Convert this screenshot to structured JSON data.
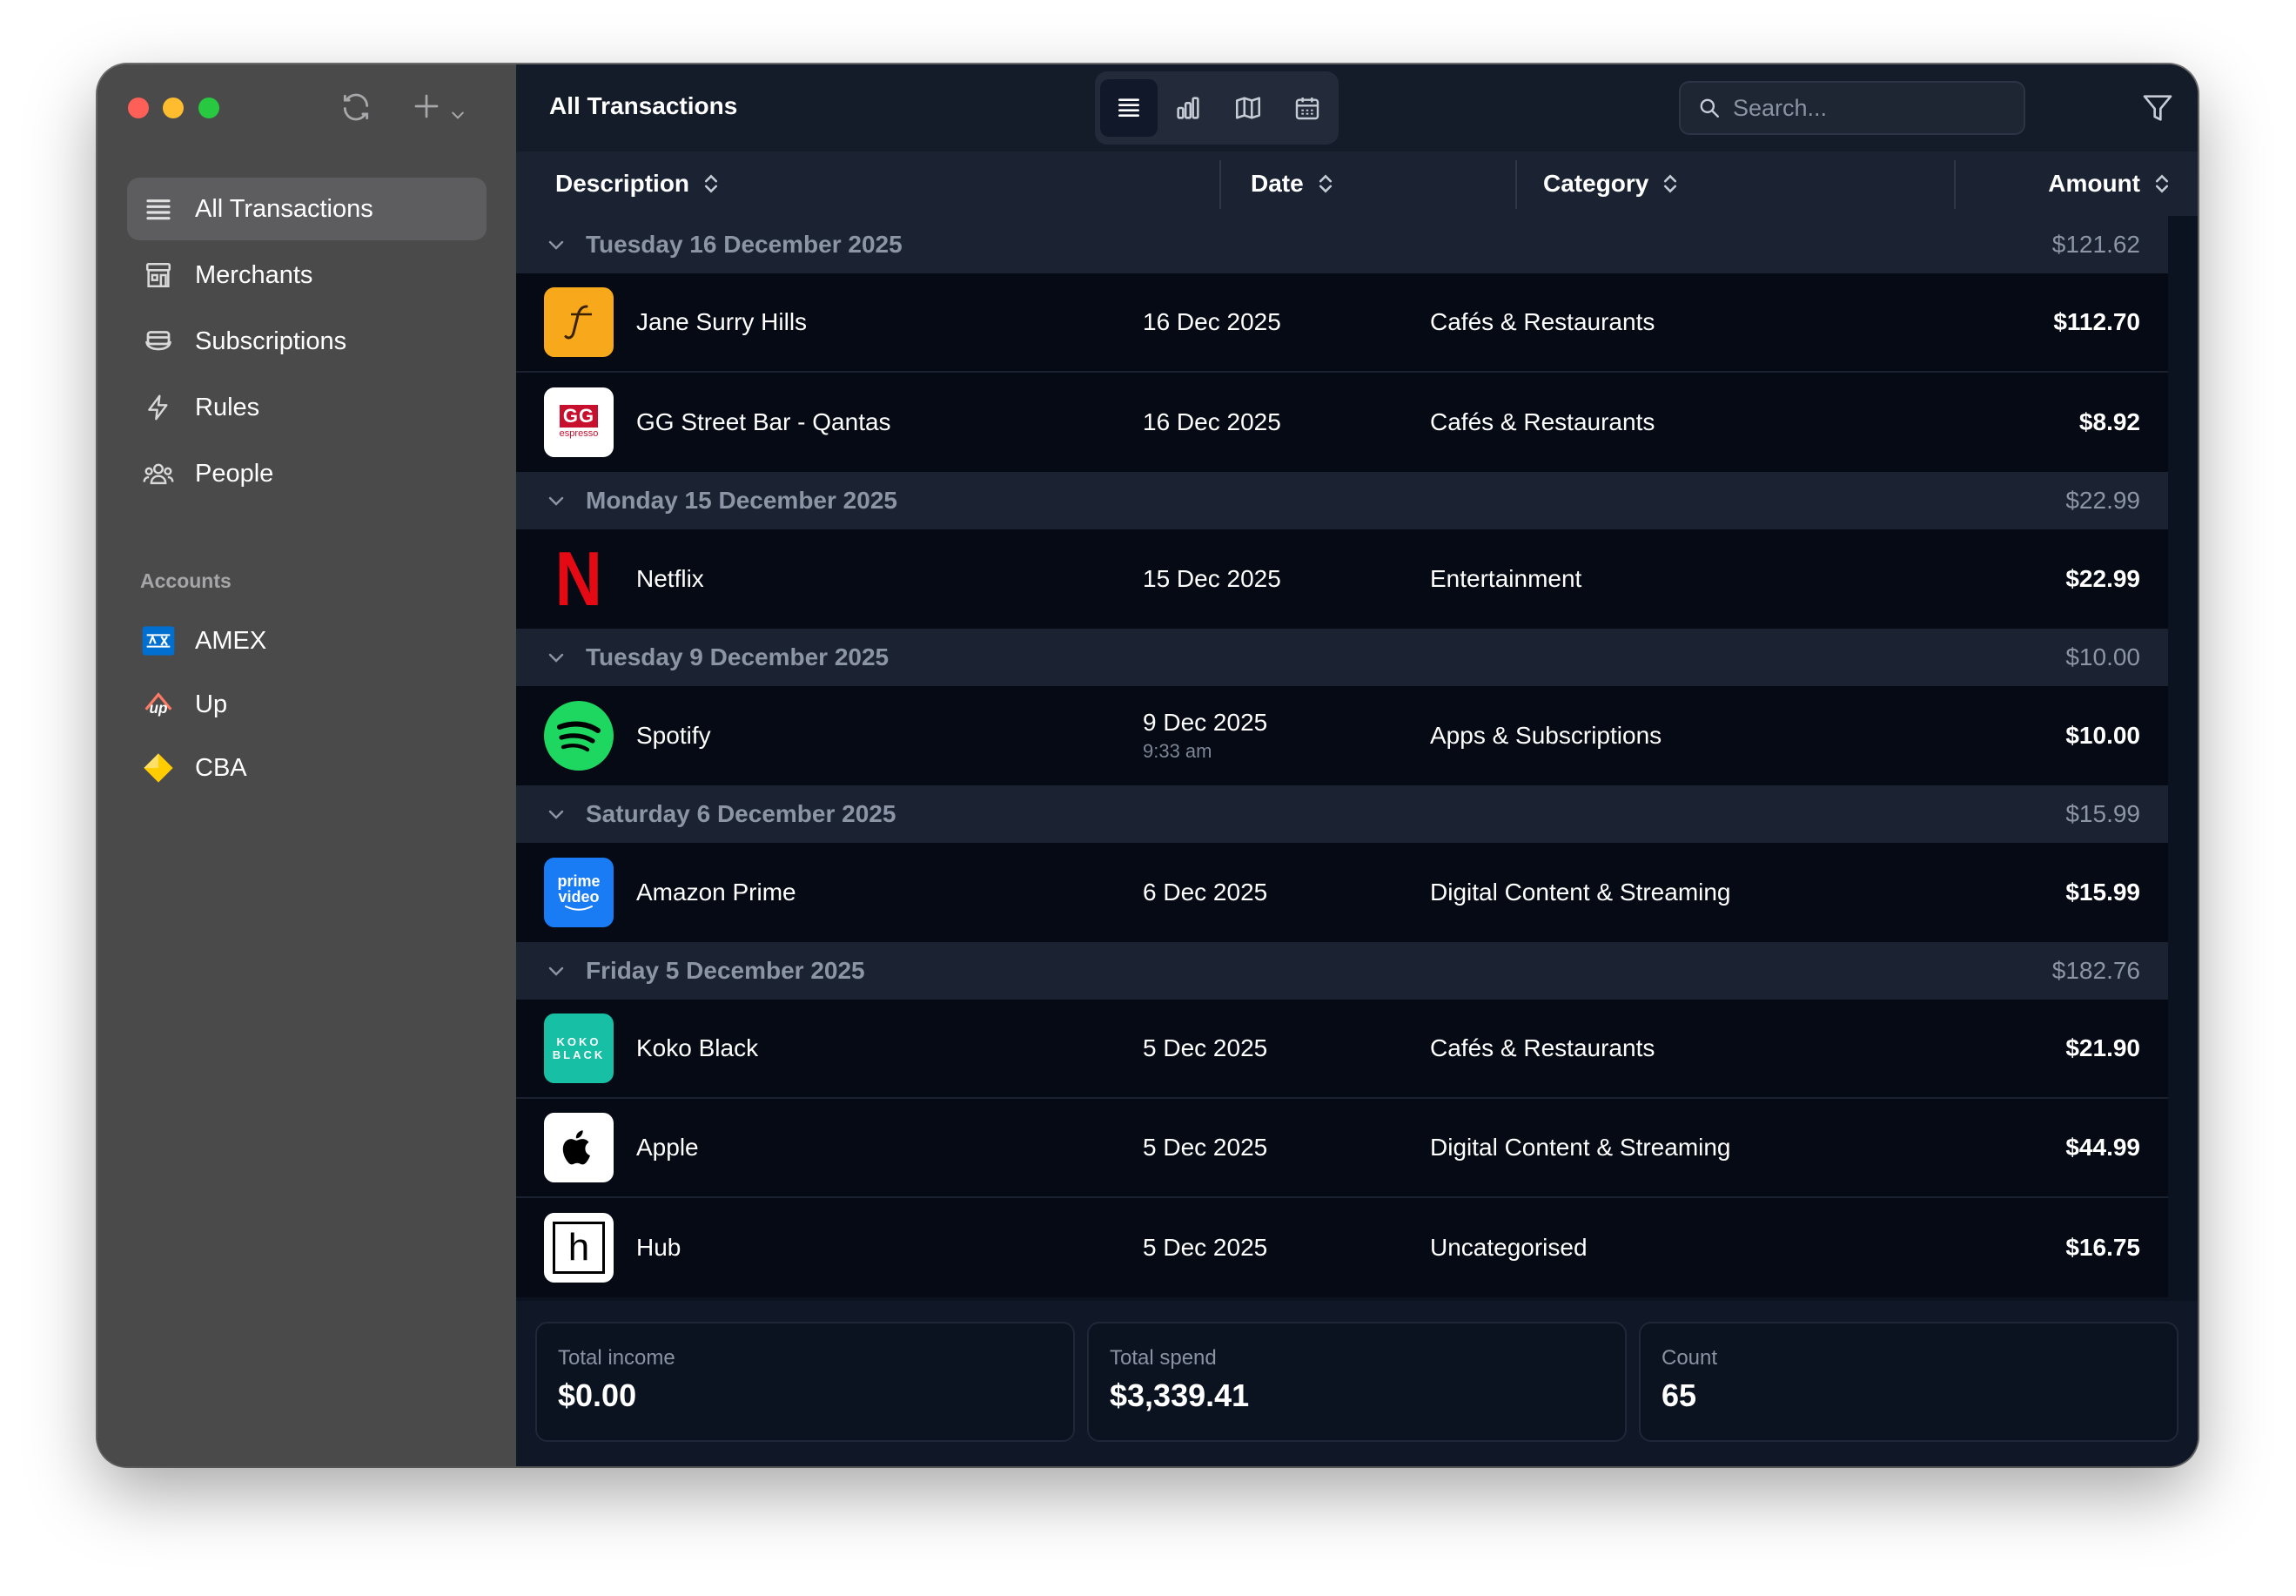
{
  "title": "All Transactions",
  "search": {
    "placeholder": "Search..."
  },
  "sidebar": {
    "items": [
      {
        "label": "All Transactions",
        "icon": "list-icon"
      },
      {
        "label": "Merchants",
        "icon": "store-icon"
      },
      {
        "label": "Subscriptions",
        "icon": "subscriptions-icon"
      },
      {
        "label": "Rules",
        "icon": "bolt-icon"
      },
      {
        "label": "People",
        "icon": "people-icon"
      }
    ],
    "accounts_heading": "Accounts",
    "accounts": [
      {
        "label": "AMEX",
        "color": "#016fd0"
      },
      {
        "label": "Up",
        "color": "#ff7a64"
      },
      {
        "label": "CBA",
        "color": "#ffcc00"
      }
    ]
  },
  "columns": {
    "description": "Description",
    "date": "Date",
    "category": "Category",
    "amount": "Amount"
  },
  "groups": [
    {
      "date": "Tuesday 16 December 2025",
      "total": "$121.62",
      "rows": [
        {
          "desc": "Jane Surry Hills",
          "date": "16 Dec 2025",
          "category": "Cafés & Restaurants",
          "amount": "$112.70",
          "logo": "jane-logo"
        },
        {
          "desc": "GG Street Bar - Qantas",
          "date": "16 Dec 2025",
          "category": "Cafés & Restaurants",
          "amount": "$8.92",
          "logo": "gg-espresso-logo",
          "logo_text": "GG",
          "logo_sub": "espresso"
        }
      ]
    },
    {
      "date": "Monday 15 December 2025",
      "total": "$22.99",
      "rows": [
        {
          "desc": "Netflix",
          "date": "15 Dec 2025",
          "category": "Entertainment",
          "amount": "$22.99",
          "logo": "netflix-logo",
          "logo_text": "N"
        }
      ]
    },
    {
      "date": "Tuesday 9 December 2025",
      "total": "$10.00",
      "rows": [
        {
          "desc": "Spotify",
          "date": "9 Dec 2025",
          "time": "9:33 am",
          "category": "Apps & Subscriptions",
          "amount": "$10.00",
          "logo": "spotify-logo"
        }
      ]
    },
    {
      "date": "Saturday 6 December 2025",
      "total": "$15.99",
      "rows": [
        {
          "desc": "Amazon Prime",
          "date": "6 Dec 2025",
          "category": "Digital Content & Streaming",
          "amount": "$15.99",
          "logo": "prime-video-logo",
          "logo_text": "prime",
          "logo_sub": "video"
        }
      ]
    },
    {
      "date": "Friday 5 December 2025",
      "total": "$182.76",
      "rows": [
        {
          "desc": "Koko Black",
          "date": "5 Dec 2025",
          "category": "Cafés & Restaurants",
          "amount": "$21.90",
          "logo": "koko-black-logo",
          "logo_text": "KOKO",
          "logo_sub": "BLACK"
        },
        {
          "desc": "Apple",
          "date": "5 Dec 2025",
          "category": "Digital Content & Streaming",
          "amount": "$44.99",
          "logo": "apple-logo"
        },
        {
          "desc": "Hub",
          "date": "5 Dec 2025",
          "category": "Uncategorised",
          "amount": "$16.75",
          "logo": "hub-logo",
          "logo_text": "h"
        }
      ]
    }
  ],
  "footer": {
    "income_label": "Total income",
    "income_value": "$0.00",
    "spend_label": "Total spend",
    "spend_value": "$3,339.41",
    "count_label": "Count",
    "count_value": "65"
  }
}
